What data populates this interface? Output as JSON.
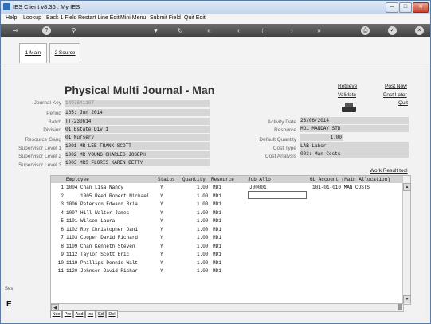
{
  "window": {
    "title": "IES Client v8.36 : My IES"
  },
  "menu": [
    "Help",
    "Lookup",
    "Back 1 Field",
    "Restart Line Edit",
    "Mini Menu",
    "Submit Field",
    "Quit Edit"
  ],
  "tabs": [
    {
      "label": "1 Main"
    },
    {
      "label": "2 Source"
    }
  ],
  "heading": "Physical Multi Journal - Man",
  "links": {
    "retrieve": "Retrieve",
    "validate": "Validate",
    "post_now": "Post Now",
    "post_later": "Post Later",
    "quit": "Quit"
  },
  "left_fields": [
    {
      "label": "Journal Key",
      "value": "1497641107"
    },
    {
      "label": "Period",
      "value": "165: Jun 2014"
    },
    {
      "label": "Batch",
      "value": "TT-230614"
    },
    {
      "label": "Division",
      "value": "01 Estate Div 1"
    },
    {
      "label": "Resource Gang",
      "value": "01 Nursery"
    },
    {
      "label": "Supervisor Level 1",
      "value": "1001 MR LEE FRANK SCOTT"
    },
    {
      "label": "Supervisor Level 2",
      "value": "1002 MR YOUNG CHARLES JOSEPH"
    },
    {
      "label": "Supervisor Level 3",
      "value": "1003 MRS FLORIS KAREN BETTY"
    }
  ],
  "right_fields": [
    {
      "label": "Activity Date",
      "value": "23/06/2014"
    },
    {
      "label": "Resource",
      "value": "MD1 MANDAY STD"
    },
    {
      "label": "Default Quantity",
      "value": "1.00"
    },
    {
      "label": "Cost Type",
      "value": "LAB Labor"
    },
    {
      "label": "Cost Analysis",
      "value": "003: Man Costs"
    }
  ],
  "work_result_tool": "Work Result tool",
  "grid": {
    "headers": [
      "Employee",
      "Status",
      "Quantity",
      "Resource",
      "Job Allo",
      "GL Account (Main Allocation)"
    ],
    "rows": [
      {
        "n": "1",
        "employee": "1004 Chan Lisa Nancy",
        "status": "Y",
        "qty": "1.00",
        "res": "MD1",
        "job": "J00001",
        "gl": "101-01-010 MAN COSTS"
      },
      {
        "n": "2",
        "employee": "     1005 Reed Robert Michael",
        "status": "Y",
        "qty": "1.00",
        "res": "MD1",
        "job": "",
        "gl": ""
      },
      {
        "n": "3",
        "employee": "1006 Peterson Edward Bria",
        "status": "Y",
        "qty": "1.00",
        "res": "MD1",
        "job": "",
        "gl": ""
      },
      {
        "n": "4",
        "employee": "1007 Hill Walter James",
        "status": "Y",
        "qty": "1.00",
        "res": "MD1",
        "job": "",
        "gl": ""
      },
      {
        "n": "5",
        "employee": "1101 Wilson Laura",
        "status": "Y",
        "qty": "1.00",
        "res": "MD1",
        "job": "",
        "gl": ""
      },
      {
        "n": "6",
        "employee": "1102 Roy Christopher Dani",
        "status": "Y",
        "qty": "1.00",
        "res": "MD1",
        "job": "",
        "gl": ""
      },
      {
        "n": "7",
        "employee": "1103 Cooper David Richard",
        "status": "Y",
        "qty": "1.00",
        "res": "MD1",
        "job": "",
        "gl": ""
      },
      {
        "n": "8",
        "employee": "1109 Chan Kenneth Steven",
        "status": "Y",
        "qty": "1.00",
        "res": "MD1",
        "job": "",
        "gl": ""
      },
      {
        "n": "9",
        "employee": "1112 Taylor Scott Eric",
        "status": "Y",
        "qty": "1.00",
        "res": "MD1",
        "job": "",
        "gl": ""
      },
      {
        "n": "10",
        "employee": "1119 Phillips Dennis Walt",
        "status": "Y",
        "qty": "1.00",
        "res": "MD1",
        "job": "",
        "gl": ""
      },
      {
        "n": "11",
        "employee": "1120 Johnson David Richar",
        "status": "Y",
        "qty": "1.00",
        "res": "MD1",
        "job": "",
        "gl": ""
      }
    ]
  },
  "bottom_buttons": [
    "Nex",
    "Pre",
    "Add",
    "Ins",
    "Ed",
    "Del"
  ],
  "side": {
    "ses": "Ses",
    "e": "E"
  },
  "colors": {
    "accent": "#2f6fb8",
    "toolbar": "#4a4a4a",
    "field_bg": "#d6d6d6"
  }
}
